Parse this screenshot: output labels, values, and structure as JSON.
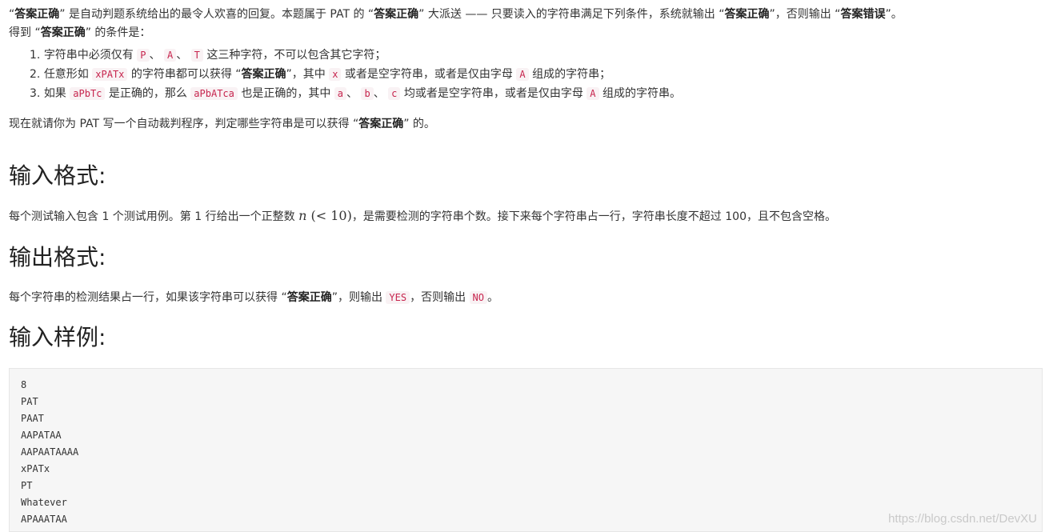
{
  "intro": {
    "q1": "“",
    "b1": "答案正确",
    "t1": "” 是自动判题系统给出的最令人欢喜的回复。本题属于 PAT 的 “",
    "b2": "答案正确",
    "t2": "” 大派送 —— 只要读入的字符串满足下列条件，系统就输出 “",
    "b3": "答案正确",
    "t3": "”，否则输出 “",
    "b4": "答案错误",
    "t4": "”。"
  },
  "conditions_title": {
    "t1": "得到 “",
    "b1": "答案正确",
    "t2": "” 的条件是："
  },
  "conditions": [
    {
      "num": "1.",
      "t1": "字符串中必须仅有 ",
      "c1": "P",
      "t2": "、 ",
      "c2": "A",
      "t3": "、 ",
      "c3": "T",
      "t4": " 这三种字符，不可以包含其它字符；"
    },
    {
      "num": "2.",
      "t1": "任意形如 ",
      "c1": "xPATx",
      "t2": " 的字符串都可以获得 “",
      "b1": "答案正确",
      "t3": "”，其中 ",
      "c2": "x",
      "t4": " 或者是空字符串，或者是仅由字母 ",
      "c3": "A",
      "t5": " 组成的字符串；"
    },
    {
      "num": "3.",
      "t1": "如果 ",
      "c1": "aPbTc",
      "t2": " 是正确的，那么 ",
      "c2": "aPbATca",
      "t3": " 也是正确的，其中 ",
      "c3": "a",
      "t4": "、 ",
      "c4": "b",
      "t5": "、 ",
      "c5": "c",
      "t6": " 均或者是空字符串，或者是仅由字母 ",
      "c6": "A",
      "t7": " 组成的字符串。"
    }
  ],
  "task": {
    "t1": "现在就请你为 PAT 写一个自动裁判程序，判定哪些字符串是可以获得 “",
    "b1": "答案正确",
    "t2": "” 的。"
  },
  "input_section": {
    "heading": "输入格式:",
    "t1": "每个测试输入包含 1 个测试用例。第 1 行给出一个正整数 ",
    "math_var": "n",
    "math_rest": " (< 10)",
    "t2": "，是需要检测的字符串个数。接下来每个字符串占一行，字符串长度不超过 100，且不包含空格。"
  },
  "output_section": {
    "heading": "输出格式:",
    "t1": "每个字符串的检测结果占一行，如果该字符串可以获得 “",
    "b1": "答案正确",
    "t2": "”，则输出 ",
    "c1": "YES",
    "t3": "，否则输出 ",
    "c2": "NO",
    "t4": "。"
  },
  "sample_section": {
    "heading": "输入样例:",
    "lines": [
      "8",
      "PAT",
      "PAAT",
      "AAPATAA",
      "AAPAATAAAA",
      "xPATx",
      "PT",
      "Whatever",
      "APAAATAA"
    ]
  },
  "watermark": "https://blog.csdn.net/DevXU",
  "colors": {
    "text": "#333333",
    "code_text": "#c7254e",
    "code_bg": "#f9f2f4",
    "pre_bg": "#f6f6f6",
    "watermark": "#c9c9c9"
  }
}
